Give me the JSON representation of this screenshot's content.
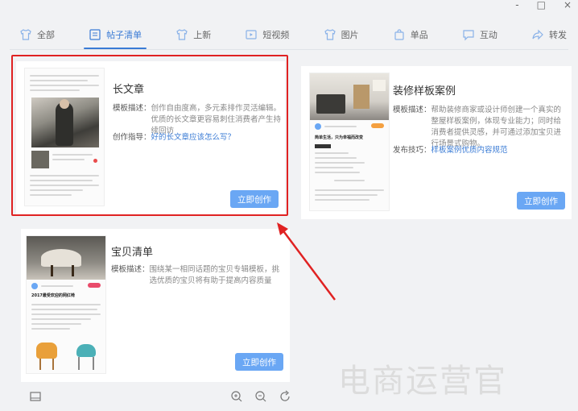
{
  "window": {
    "controls": [
      "-",
      "□",
      "×"
    ]
  },
  "nav": [
    {
      "label": "全部",
      "icon": "shirt-icon"
    },
    {
      "label": "帖子清单",
      "icon": "list-icon",
      "active": true
    },
    {
      "label": "上新",
      "icon": "shirt-icon"
    },
    {
      "label": "短视频",
      "icon": "video-icon"
    },
    {
      "label": "图片",
      "icon": "shirt-icon"
    },
    {
      "label": "单品",
      "icon": "bag-icon"
    },
    {
      "label": "互动",
      "icon": "chat-icon"
    },
    {
      "label": "转发",
      "icon": "share-icon"
    }
  ],
  "cards": [
    {
      "title": "长文章",
      "desc_label": "模板描述：",
      "desc": "创作自由度高，多元素排作灵活编辑。优质的长文章更容易刺住消费者产生持续回访",
      "guide_label": "创作指导：",
      "guide_link": "好的长文章应该怎么写？",
      "cta": "立即创作"
    },
    {
      "title": "装修样板案例",
      "desc_label": "模板描述：",
      "desc": "帮助装修商家或设计师创建一个真实的整屋样板案例，体现专业能力；同时给消费者提供灵感，并可通过添加宝贝进行场景式购物。",
      "guide_label": "发布技巧：",
      "guide_link": "样板案例优质内容规范",
      "cta": "立即创作"
    },
    {
      "title": "宝贝清单",
      "desc_label": "模板描述：",
      "desc": "围绕某一相同话题的宝贝专辑模板，挑选优质的宝贝将有助于提高内容质量",
      "cta": "立即创作"
    }
  ],
  "thumb3": {
    "headline": "2017最受欢迎的网红椅"
  },
  "thumb2": {
    "headline": "简单生活，只为幸福而改变"
  },
  "watermark": "电商运营官",
  "colors": {
    "accent": "#3a7bd5",
    "button": "#6aa7f4",
    "highlight": "#e02222"
  }
}
